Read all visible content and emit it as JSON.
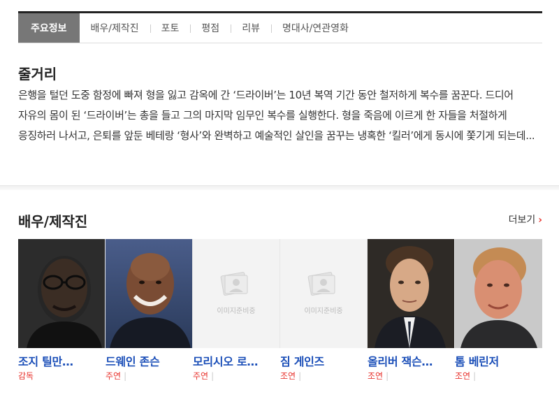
{
  "tabs": [
    {
      "label": "주요정보"
    },
    {
      "label": "배우/제작진"
    },
    {
      "label": "포토"
    },
    {
      "label": "평점"
    },
    {
      "label": "리뷰"
    },
    {
      "label": "명대사/연관영화"
    }
  ],
  "synopsis": {
    "title": "줄거리",
    "text": "은행을 털던 도중 함정에 빠져 형을 잃고 감옥에 간 ‘드라이버’는 10년 복역 기간 동안 철저하게 복수를 꿈꾼다. 드디어 자유의 몸이 된 ‘드라이버’는 총을 들고 그의 마지막 임무인 복수를 실행한다. 형을 죽음에 이르게 한 자들을 처절하게 응징하러 나서고, 은퇴를 앞둔 베테랑 ‘형사’와 완벽하고 예술적인 살인을 꿈꾸는 냉혹한 ‘킬러’에게 동시에 쫓기게 되는데..."
  },
  "cast_section": {
    "title": "배우/제작진",
    "more_label": "더보기"
  },
  "cast": [
    {
      "name": "조지 틸만…",
      "role": "감독"
    },
    {
      "name": "드웨인 존슨",
      "role": "주연"
    },
    {
      "name": "모리시오 로…",
      "role": "주연"
    },
    {
      "name": "짐 게인즈",
      "role": "조연"
    },
    {
      "name": "올리버 잭슨…",
      "role": "조연"
    },
    {
      "name": "톰 베린저",
      "role": "조연"
    }
  ],
  "placeholder_text": "이미지준비중",
  "colors": {
    "accent": "#e8352f",
    "link": "#1a4eb8",
    "tab_active": "#777777"
  }
}
